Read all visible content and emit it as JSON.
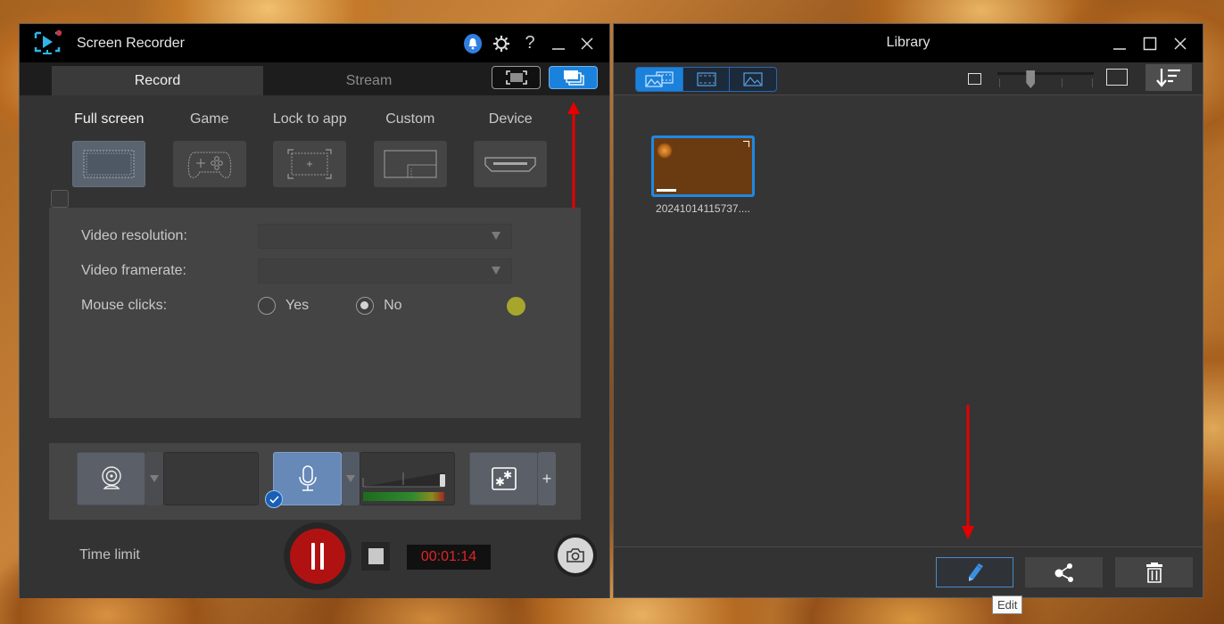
{
  "recorder": {
    "title": "Screen Recorder",
    "titlebar_icons": [
      "notification-bell-icon",
      "settings-gear-icon",
      "help-icon",
      "minimize-icon",
      "close-icon"
    ],
    "tabs": [
      {
        "label": "Record",
        "active": true
      },
      {
        "label": "Stream",
        "active": false
      }
    ],
    "mode_buttons": [
      {
        "name": "fullscreen-mode-icon",
        "active": false
      },
      {
        "name": "library-mode-icon",
        "active": true
      }
    ],
    "capture_modes": [
      {
        "label": "Full screen",
        "icon": "full-screen-icon",
        "active": true
      },
      {
        "label": "Game",
        "icon": "gamepad-icon",
        "active": false
      },
      {
        "label": "Lock to app",
        "icon": "lock-to-app-icon",
        "active": false
      },
      {
        "label": "Custom",
        "icon": "custom-region-icon",
        "active": false
      },
      {
        "label": "Device",
        "icon": "hdmi-device-icon",
        "active": false
      }
    ],
    "settings": {
      "video_resolution_label": "Video resolution:",
      "video_resolution_value": "",
      "video_framerate_label": "Video framerate:",
      "video_framerate_value": "",
      "mouse_clicks_label": "Mouse clicks:",
      "mouse_clicks_options": [
        {
          "label": "Yes",
          "checked": false
        },
        {
          "label": "No",
          "checked": true
        }
      ],
      "click_color": "#a6a62c"
    },
    "devices": {
      "webcam_icon": "webcam-icon",
      "microphone_icon": "microphone-icon",
      "microphone_enabled": true,
      "effects_icon": "effects-icon",
      "add_label": "+"
    },
    "bottom": {
      "time_limit_label": "Time limit",
      "time_limit_checked": false,
      "timer": "00:01:14"
    }
  },
  "library": {
    "title": "Library",
    "view_buttons": [
      {
        "name": "all-media-view-icon",
        "active": true
      },
      {
        "name": "video-view-icon",
        "active": false
      },
      {
        "name": "image-view-icon",
        "active": false
      }
    ],
    "thumbnail_size_slider": 0.33,
    "items": [
      {
        "filename": "20241014115737....",
        "selected": true
      }
    ],
    "actions": [
      {
        "name": "edit",
        "icon": "pencil-icon"
      },
      {
        "name": "share",
        "icon": "share-icon"
      },
      {
        "name": "delete",
        "icon": "trash-icon"
      }
    ],
    "tooltip": "Edit"
  },
  "colors": {
    "accent_blue": "#1a82dc",
    "record_red": "#b01212",
    "timer_red": "#e02525",
    "annotation_red": "#e60000"
  }
}
